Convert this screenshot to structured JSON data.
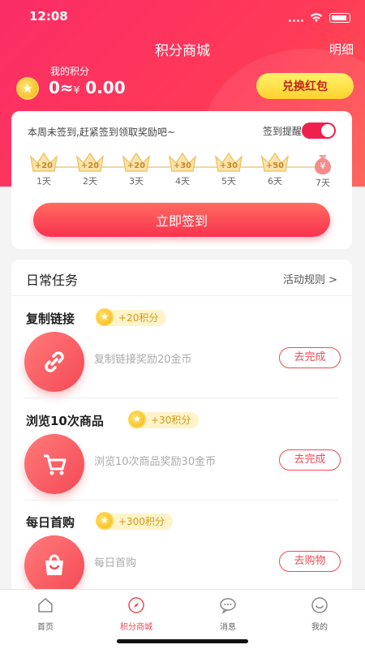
{
  "status": {
    "time": "12:08"
  },
  "header": {
    "title": "积分商城",
    "detail": "明细"
  },
  "points": {
    "label": "我的积分",
    "value": "0≈",
    "currency": "¥",
    "amount": "0.00"
  },
  "redeem_button": "兑换红包",
  "signin": {
    "tip": "本周未签到,赶紧签到领取奖励吧~",
    "remind_label": "签到提醒",
    "remind_on": true,
    "days": [
      {
        "label": "1天",
        "bonus": "+20"
      },
      {
        "label": "2天",
        "bonus": "+20"
      },
      {
        "label": "3天",
        "bonus": "+20"
      },
      {
        "label": "4天",
        "bonus": "+30"
      },
      {
        "label": "5天",
        "bonus": "+30"
      },
      {
        "label": "6天",
        "bonus": "+50"
      },
      {
        "label": "7天",
        "bonus": "¥"
      }
    ],
    "button": "立即签到"
  },
  "tasks": {
    "title": "日常任务",
    "rules": "活动规则 >",
    "items": [
      {
        "name": "复制链接",
        "reward": "+20积分",
        "desc": "复制链接奖励20金币",
        "action": "去完成",
        "icon": "link-icon"
      },
      {
        "name": "浏览10次商品",
        "reward": "+30积分",
        "desc": "浏览10次商品奖励30金币",
        "action": "去完成",
        "icon": "cart-icon"
      },
      {
        "name": "每日首购",
        "reward": "+300积分",
        "desc": "每日首购",
        "action": "去购物",
        "icon": "shopping-bag-icon"
      }
    ]
  },
  "tabbar": [
    {
      "label": "首页",
      "icon": "home-icon",
      "active": false
    },
    {
      "label": "积分商城",
      "icon": "compass-icon",
      "active": true
    },
    {
      "label": "消息",
      "icon": "message-icon",
      "active": false
    },
    {
      "label": "我的",
      "icon": "profile-icon",
      "active": false
    }
  ],
  "colors": {
    "primary": "#f44a55",
    "gold": "#ffd22e"
  }
}
